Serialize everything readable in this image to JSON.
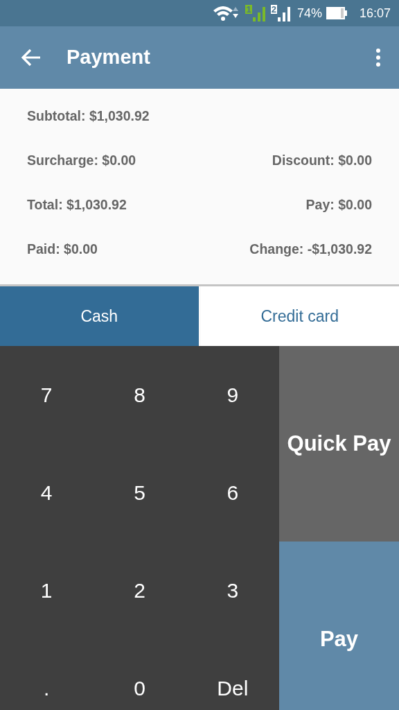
{
  "status_bar": {
    "sims": [
      {
        "label": "1",
        "color": "#7ab929"
      },
      {
        "label": "2",
        "color": "#ffffff"
      }
    ],
    "battery": "74%",
    "time": "16:07"
  },
  "app_bar": {
    "title": "Payment"
  },
  "summary": [
    {
      "left": "Subtotal: $1,030.92"
    },
    {
      "left": "Surcharge: $0.00",
      "right": "Discount: $0.00"
    },
    {
      "left": "Total: $1,030.92",
      "right": "Pay: $0.00"
    },
    {
      "left": "Paid: $0.00",
      "right": "Change: -$1,030.92"
    }
  ],
  "tabs": [
    {
      "label": "Cash",
      "selected": true
    },
    {
      "label": "Credit card",
      "selected": false
    }
  ],
  "keypad": [
    "7",
    "8",
    "9",
    "4",
    "5",
    "6",
    "1",
    "2",
    "3",
    ".",
    "0",
    "Del"
  ],
  "side_buttons": [
    {
      "label": "Quick Pay",
      "kind": "quick"
    },
    {
      "label": "Pay",
      "kind": "pay"
    }
  ]
}
